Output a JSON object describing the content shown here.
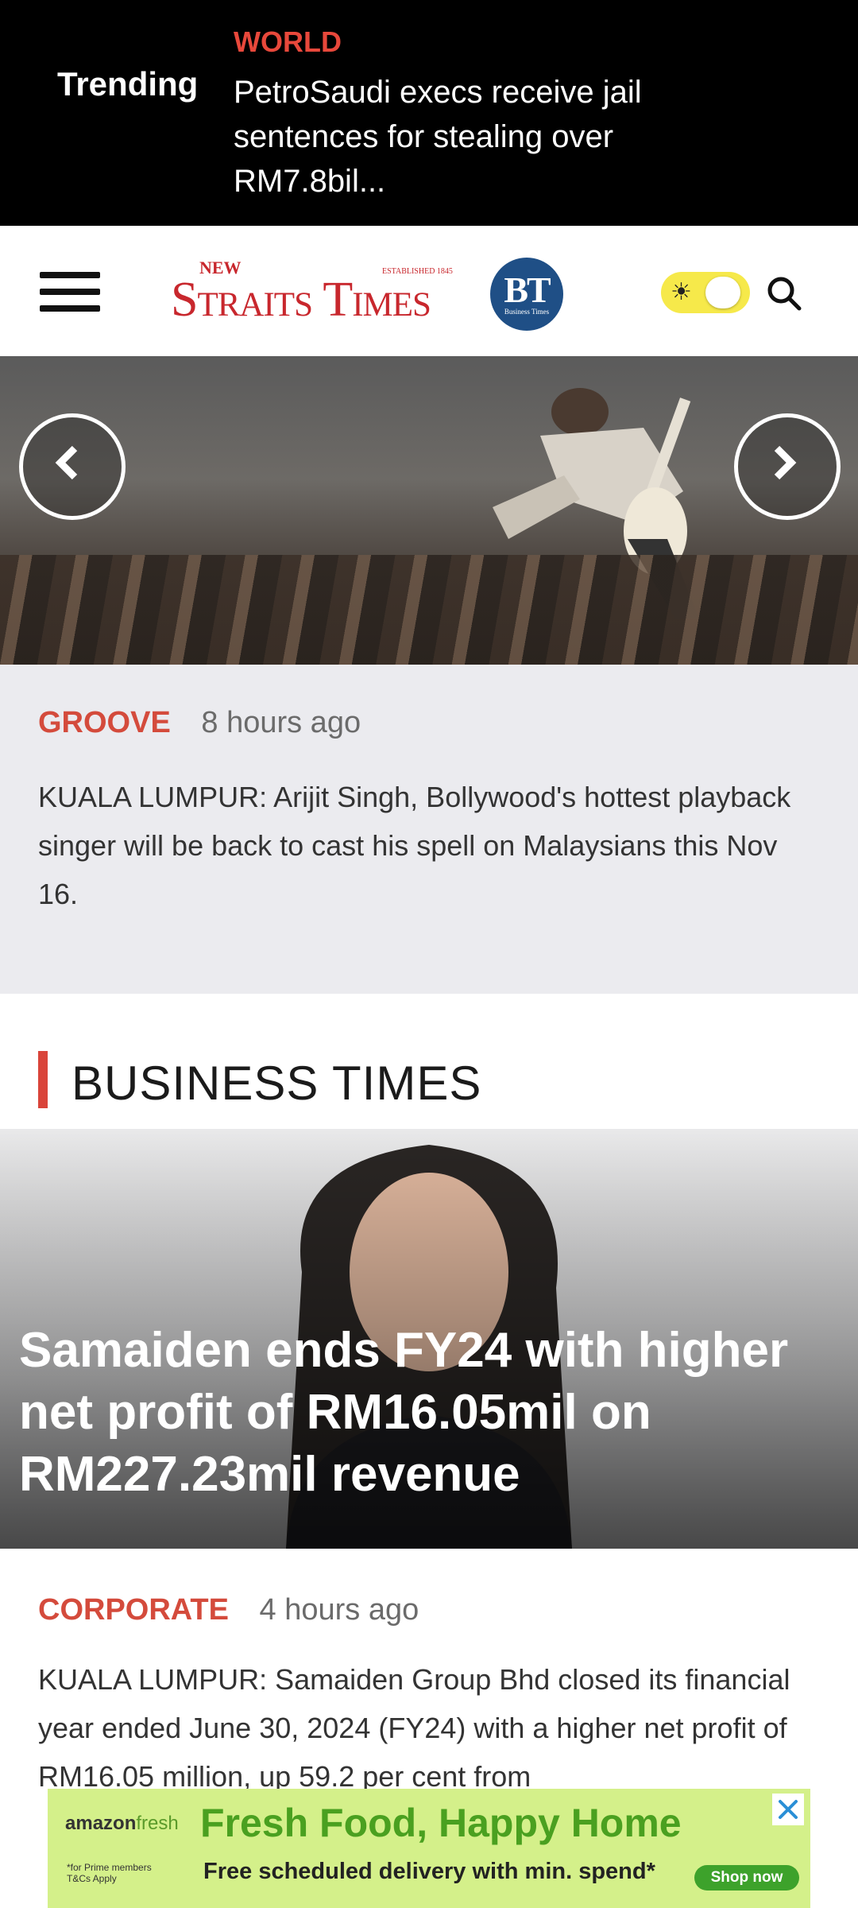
{
  "trending": {
    "label": "Trending",
    "category": "WORLD",
    "headline": "PetroSaudi execs receive jail sentences for stealing over RM7.8bil..."
  },
  "header": {
    "logo_new": "NEW",
    "logo_established": "ESTABLISHED 1845",
    "logo_name": "Straits Times",
    "bt_logo": "BT",
    "bt_logo_sub": "Business Times",
    "theme_toggle_icon": "sun-icon",
    "search_icon": "search-icon"
  },
  "hero": {
    "category": "GROOVE",
    "time": "8 hours ago",
    "summary": "KUALA LUMPUR: Arijit Singh, Bollywood's hottest playback singer will be back to cast his spell on Malaysians this Nov 16."
  },
  "section": {
    "title": "BUSINESS TIMES"
  },
  "story": {
    "headline": "Samaiden ends FY24 with higher net profit of RM16.05mil on RM227.23mil revenue",
    "category": "CORPORATE",
    "time": "4 hours ago",
    "summary": "KUALA LUMPUR: Samaiden Group Bhd closed its financial year ended June 30, 2024 (FY24) with a higher net profit of RM16.05 million, up 59.2 per cent from"
  },
  "ad": {
    "brand": "amazon",
    "brand_fresh": "fresh",
    "headline": "Fresh Food, Happy Home",
    "subline": "Free scheduled delivery with min. spend*",
    "fine_print": "*for Prime members T&Cs Apply",
    "cta": "Shop now",
    "close_icon": "close-icon"
  },
  "colors": {
    "accent_red": "#d44b3c",
    "trending_bg": "#000000",
    "caption_bg": "#ebebef",
    "toggle_yellow": "#f6e94a",
    "ad_bg": "#d4f08a"
  }
}
